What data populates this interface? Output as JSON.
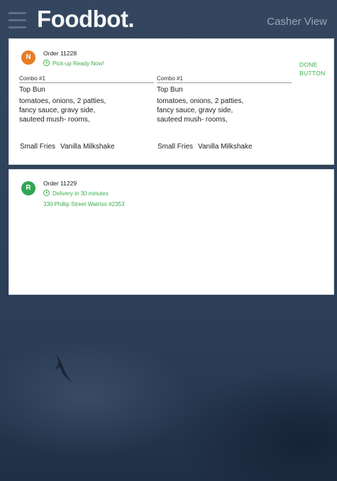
{
  "header": {
    "brand": "Foodbot.",
    "view_label": "Casher View"
  },
  "orders": [
    {
      "avatar_letter": "N",
      "avatar_color": "#e97c24",
      "order_label": "Order 11228",
      "status_text": "Pick-up Ready Now!",
      "done_button": "DONE\nBUTTON",
      "items": [
        {
          "title": "Combo #1",
          "bun": "Top Bun",
          "details": "tomatoes, onions, 2 patties, fancy sauce, gravy side, sauteed mush- rooms,",
          "side": "Small Fries",
          "drink": "Vanilla Milkshake"
        },
        {
          "title": "Combo #1",
          "bun": "Top Bun",
          "details": "tomatoes, onions, 2 patties, fancy sauce, gravy side, sauteed mush- rooms,",
          "side": "Small Fries",
          "drink": "Vanilla Milkshake"
        }
      ]
    },
    {
      "avatar_letter": "R",
      "avatar_color": "#2fa653",
      "order_label": "Order 11229",
      "status_text": "Delivery in 30 minutes",
      "address": "330 Phillip Street Watrloo #2353"
    }
  ],
  "colors": {
    "accent_green": "#3cae4a",
    "background": "#2f425b"
  },
  "icons": [
    "hamburger-menu-icon",
    "clock-icon",
    "bird-icon"
  ]
}
